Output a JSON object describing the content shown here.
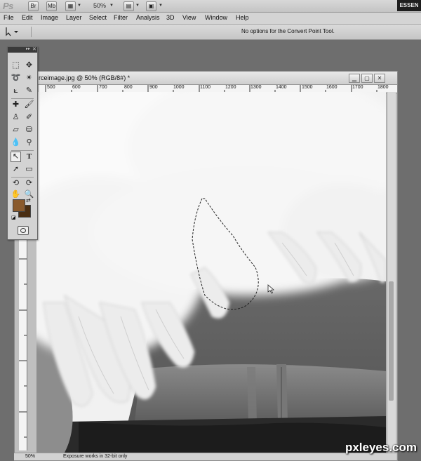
{
  "app": {
    "logo": "Ps",
    "bridge_label": "Br",
    "minibridge_label": "Mb",
    "zoom": "50%",
    "workspace": "ESSEN"
  },
  "menu": [
    "File",
    "Edit",
    "Image",
    "Layer",
    "Select",
    "Filter",
    "Analysis",
    "3D",
    "View",
    "Window",
    "Help"
  ],
  "options": {
    "tool_icon": "convert-point-icon",
    "message": "No options for the Convert Point Tool."
  },
  "document": {
    "title": "rceimage.jpg @ 50% (RGB/8#) *",
    "ruler_ticks": [
      "500",
      "600",
      "700",
      "800",
      "900",
      "1000",
      "1100",
      "1200",
      "1300",
      "1400",
      "1500",
      "1600",
      "1700",
      "1800"
    ]
  },
  "status": {
    "zoom": "50%",
    "info": "Exposure works in 32-bit only"
  },
  "toolbox": {
    "fg_color": "#8a5a2c",
    "bg_color": "#4a2e12"
  },
  "watermark": "pxleyes.com"
}
